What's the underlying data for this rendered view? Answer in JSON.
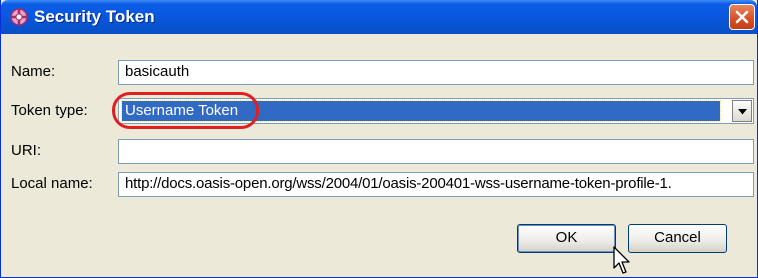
{
  "window": {
    "title": "Security Token"
  },
  "form": {
    "name_label": "Name:",
    "name_value": "basicauth",
    "token_type_label": "Token type:",
    "token_type_value": "Username Token",
    "uri_label": "URI:",
    "uri_value": "",
    "local_name_label": "Local name:",
    "local_name_value": "http://docs.oasis-open.org/wss/2004/01/oasis-200401-wss-username-token-profile-1."
  },
  "buttons": {
    "ok": "OK",
    "cancel": "Cancel"
  },
  "icons": {
    "title": "security-token-icon",
    "close": "close-icon",
    "dropdown": "chevron-down-icon",
    "cursor": "mouse-pointer-icon"
  },
  "colors": {
    "titlebar": "#0a58e0",
    "selection": "#316ac5",
    "highlight_ring": "#e02020",
    "dialog_bg": "#ece9d8"
  }
}
